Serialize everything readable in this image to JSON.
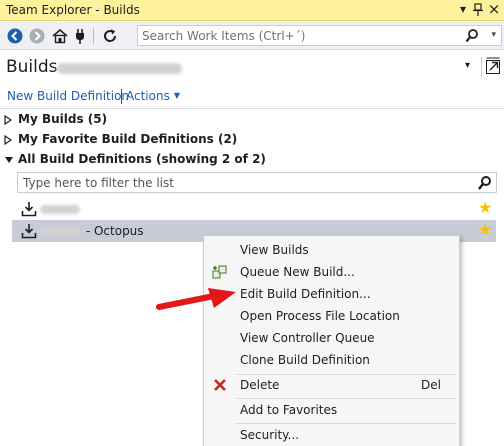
{
  "window": {
    "title": "Team Explorer - Builds",
    "pin_glyph": "▾",
    "pushpin_glyph": "⌂",
    "close_glyph": "×"
  },
  "toolbar": {
    "buttons": [
      "back-icon",
      "forward-icon",
      "home-icon",
      "connect-icon",
      "refresh-icon"
    ],
    "search_placeholder": "Search Work Items (Ctrl+´)",
    "search_dropdown_glyph": "▾"
  },
  "header": {
    "title": "Builds",
    "dropdown_glyph": "▾"
  },
  "actions": {
    "new_build_definition": "New Build Definition",
    "actions_label": "Actions",
    "actions_caret": "▼"
  },
  "sections": [
    {
      "label": "My Builds (5)",
      "expanded": false
    },
    {
      "label": "My Favorite Build Definitions (2)",
      "expanded": false
    },
    {
      "label": "All Build Definitions (showing 2 of 2)",
      "expanded": true
    }
  ],
  "filter": {
    "placeholder": "Type here to filter the list"
  },
  "definitions": [
    {
      "suffix": "",
      "favorite_glyph": "★",
      "selected": false
    },
    {
      "suffix": "- Octopus",
      "favorite_glyph": "★",
      "selected": true
    }
  ],
  "context_menu": {
    "items": [
      {
        "label": "View Builds",
        "icon": "",
        "shortcut": ""
      },
      {
        "label": "Queue New Build...",
        "icon": "queue-build-icon",
        "shortcut": ""
      },
      {
        "label": "Edit Build Definition...",
        "icon": "",
        "shortcut": ""
      },
      {
        "label": "Open Process File Location",
        "icon": "",
        "shortcut": ""
      },
      {
        "label": "View Controller Queue",
        "icon": "",
        "shortcut": ""
      },
      {
        "label": "Clone Build Definition",
        "icon": "",
        "shortcut": ""
      },
      {
        "label": "Delete",
        "icon": "delete-icon",
        "shortcut": "Del"
      },
      {
        "label": "Add to Favorites",
        "icon": "",
        "shortcut": ""
      },
      {
        "label": "Security...",
        "icon": "",
        "shortcut": ""
      }
    ]
  },
  "colors": {
    "title_bar": "#fff29d",
    "link": "#1a5fb4",
    "selected_row": "#c9cbd6",
    "star": "#f5c400",
    "annotation_arrow": "#e3161b",
    "delete_icon": "#c4281c"
  }
}
